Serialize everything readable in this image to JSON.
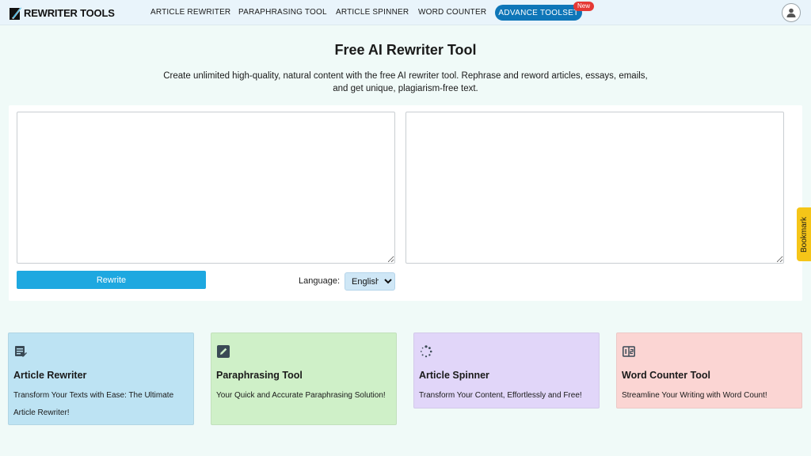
{
  "header": {
    "logo_text": "REWRITER TOOLS",
    "nav": [
      {
        "label": "ARTICLE REWRITER"
      },
      {
        "label": "PARAPHRASING TOOL"
      },
      {
        "label": "ARTICLE SPINNER"
      },
      {
        "label": "WORD COUNTER"
      }
    ],
    "advance_label": "ADVANCE TOOLSET",
    "new_badge": "New",
    "user_icon": "user-icon",
    "accent_color": "#0e76b8"
  },
  "hero": {
    "title": "Free AI Rewriter Tool",
    "subtitle": "Create unlimited high-quality, natural content with the free AI rewriter tool. Rephrase and reword articles, essays, emails, and get unique, plagiarism-free text."
  },
  "editor": {
    "input_value": "",
    "output_value": "",
    "rewrite_label": "Rewrite",
    "language_label": "Language:",
    "language_selected": "English",
    "button_color": "#1ea8e0"
  },
  "bookmark": {
    "label": "Bookmark",
    "color": "#f5c518"
  },
  "cards": [
    {
      "title": "Article Rewriter",
      "desc": "Transform Your Texts with Ease: The Ultimate Article Rewriter!",
      "icon": "article-icon",
      "color": "#bde3f3"
    },
    {
      "title": "Paraphrasing Tool",
      "desc": "Your Quick and Accurate Paraphrasing Solution!",
      "icon": "edit-icon",
      "color": "#cff0c8"
    },
    {
      "title": "Article Spinner",
      "desc": "Transform Your Content, Effortlessly and Free!",
      "icon": "spinner-icon",
      "color": "#e1d6f9"
    },
    {
      "title": "Word Counter Tool",
      "desc": "Streamline Your Writing with Word Count!",
      "icon": "counter-icon",
      "color": "#fbd5d3"
    }
  ]
}
